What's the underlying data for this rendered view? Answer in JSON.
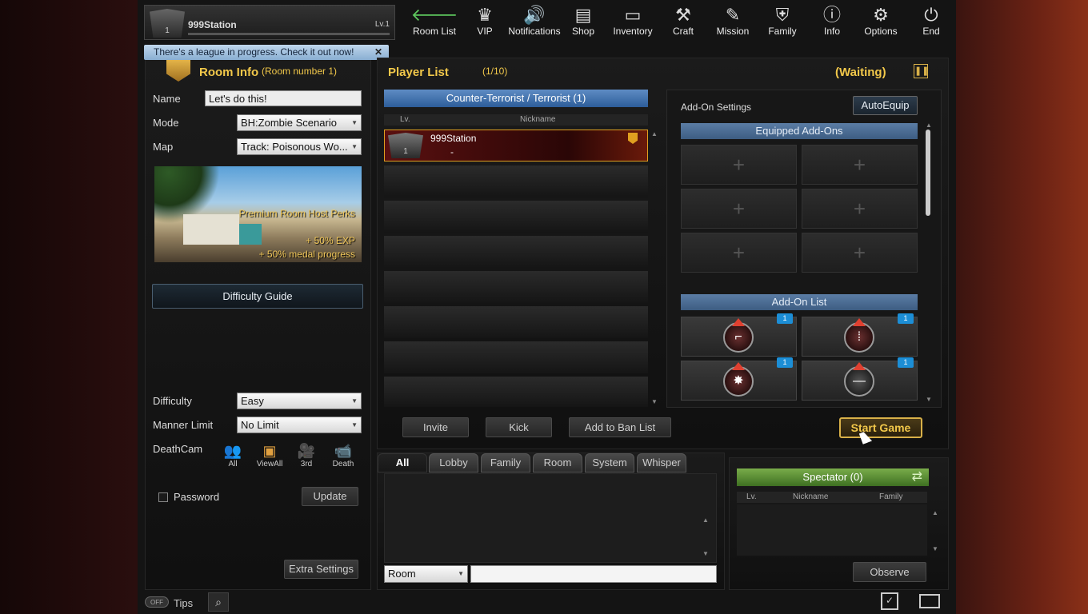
{
  "profile": {
    "level_badge": "1",
    "name": "999Station",
    "level": "Lv.1"
  },
  "nav": [
    {
      "label": "Room List",
      "icon": "back-arrow-icon"
    },
    {
      "label": "VIP",
      "icon": "crown-icon"
    },
    {
      "label": "Notifications",
      "icon": "speaker-icon"
    },
    {
      "label": "Shop",
      "icon": "shop-icon"
    },
    {
      "label": "Inventory",
      "icon": "briefcase-icon"
    },
    {
      "label": "Craft",
      "icon": "craft-icon"
    },
    {
      "label": "Mission",
      "icon": "mission-icon"
    },
    {
      "label": "Family",
      "icon": "family-shield-icon"
    },
    {
      "label": "Info",
      "icon": "info-icon"
    },
    {
      "label": "Options",
      "icon": "gear-icon"
    },
    {
      "label": "End",
      "icon": "power-icon"
    }
  ],
  "notice": {
    "text": "There's a league in progress. Check it out now!",
    "close": "✕"
  },
  "room_info": {
    "title": "Room Info",
    "room_number": "(Room number 1)",
    "name_label": "Name",
    "name_value": "Let's do this!",
    "mode_label": "Mode",
    "mode_value": "BH:Zombie Scenario",
    "map_label": "Map",
    "map_value": "Track: Poisonous Wo...",
    "perk_title": "Premium Room Host Perks",
    "perk_exp": "+ 50% EXP",
    "perk_medal": "+ 50% medal progress",
    "difficulty_guide": "Difficulty Guide",
    "difficulty_label": "Difficulty",
    "difficulty_value": "Easy",
    "manner_label": "Manner Limit",
    "manner_value": "No Limit",
    "deathcam_label": "DeathCam",
    "deathcam_options": [
      "All",
      "ViewAll",
      "3rd",
      "Death"
    ],
    "password_label": "Password",
    "update_label": "Update",
    "extra_settings": "Extra Settings"
  },
  "player_list": {
    "title": "Player List",
    "count": "(1/10)",
    "status": "(Waiting)",
    "team_header": "Counter-Terrorist / Terrorist (1)",
    "col_level": "Lv.",
    "col_nickname": "Nickname",
    "players": [
      {
        "level": "1",
        "name": "999Station",
        "sub": "-"
      }
    ],
    "invite": "Invite",
    "kick": "Kick",
    "ban": "Add to Ban List"
  },
  "addon": {
    "title": "Add-On Settings",
    "auto_equip": "AutoEquip",
    "equipped_header": "Equipped Add-Ons",
    "list_header": "Add-On List",
    "slot_plus": "+",
    "badge": "1"
  },
  "start_game": "Start Game",
  "chat": {
    "tabs": [
      "All",
      "Lobby",
      "Family",
      "Room",
      "System",
      "Whisper"
    ],
    "channel": "Room"
  },
  "spectator": {
    "header": "Spectator (0)",
    "col_level": "Lv.",
    "col_nickname": "Nickname",
    "col_family": "Family",
    "observe": "Observe"
  },
  "bottom": {
    "toggle": "OFF",
    "tips": "Tips"
  }
}
